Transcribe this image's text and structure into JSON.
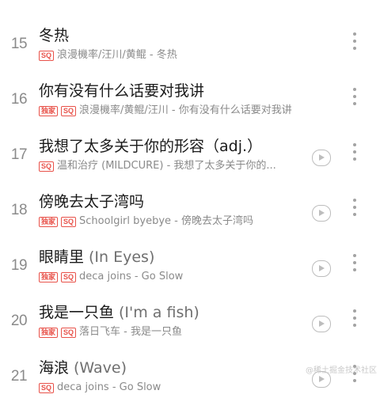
{
  "songs": [
    {
      "number": "15",
      "title": "冬热",
      "subtitle_paren": "",
      "exclusive": false,
      "sq": true,
      "subtitle": "浪漫機率/汪川/黄鲲 - 冬热",
      "has_mv": false
    },
    {
      "number": "16",
      "title": "你有没有什么话要对我讲",
      "subtitle_paren": "",
      "exclusive": true,
      "sq": true,
      "subtitle": "浪漫機率/黄鲲/汪川 - 你有没有什么话要对我讲",
      "has_mv": false
    },
    {
      "number": "17",
      "title": "我想了太多关于你的形容（adj.）",
      "subtitle_paren": "",
      "exclusive": false,
      "sq": true,
      "subtitle": "温和治疗 (MILDCURE) - 我想了太多关于你的...",
      "has_mv": true
    },
    {
      "number": "18",
      "title": "傍晚去太子湾吗",
      "subtitle_paren": "",
      "exclusive": true,
      "sq": true,
      "subtitle": "Schoolgirl byebye - 傍晚去太子湾吗",
      "has_mv": true
    },
    {
      "number": "19",
      "title": "眼睛里",
      "subtitle_paren": "(In Eyes)",
      "exclusive": true,
      "sq": true,
      "subtitle": "deca joins - Go Slow",
      "has_mv": true
    },
    {
      "number": "20",
      "title": "我是一只鱼",
      "subtitle_paren": "(I'm a fish)",
      "exclusive": true,
      "sq": true,
      "subtitle": "落日飞车 - 我是一只鱼",
      "has_mv": true
    },
    {
      "number": "21",
      "title": "海浪",
      "subtitle_paren": "(Wave)",
      "exclusive": false,
      "sq": true,
      "subtitle": "deca joins - Go Slow",
      "has_mv": true
    }
  ],
  "badges": {
    "exclusive": "独家",
    "sq": "SQ"
  },
  "icons": {
    "mv": "play-circle-icon",
    "more": "vertical-dots-icon"
  },
  "colors": {
    "badge": "#e8524a",
    "title": "#1a1a1a",
    "secondary": "#8a8a8a"
  },
  "watermark": "@稀土掘金技术社区"
}
